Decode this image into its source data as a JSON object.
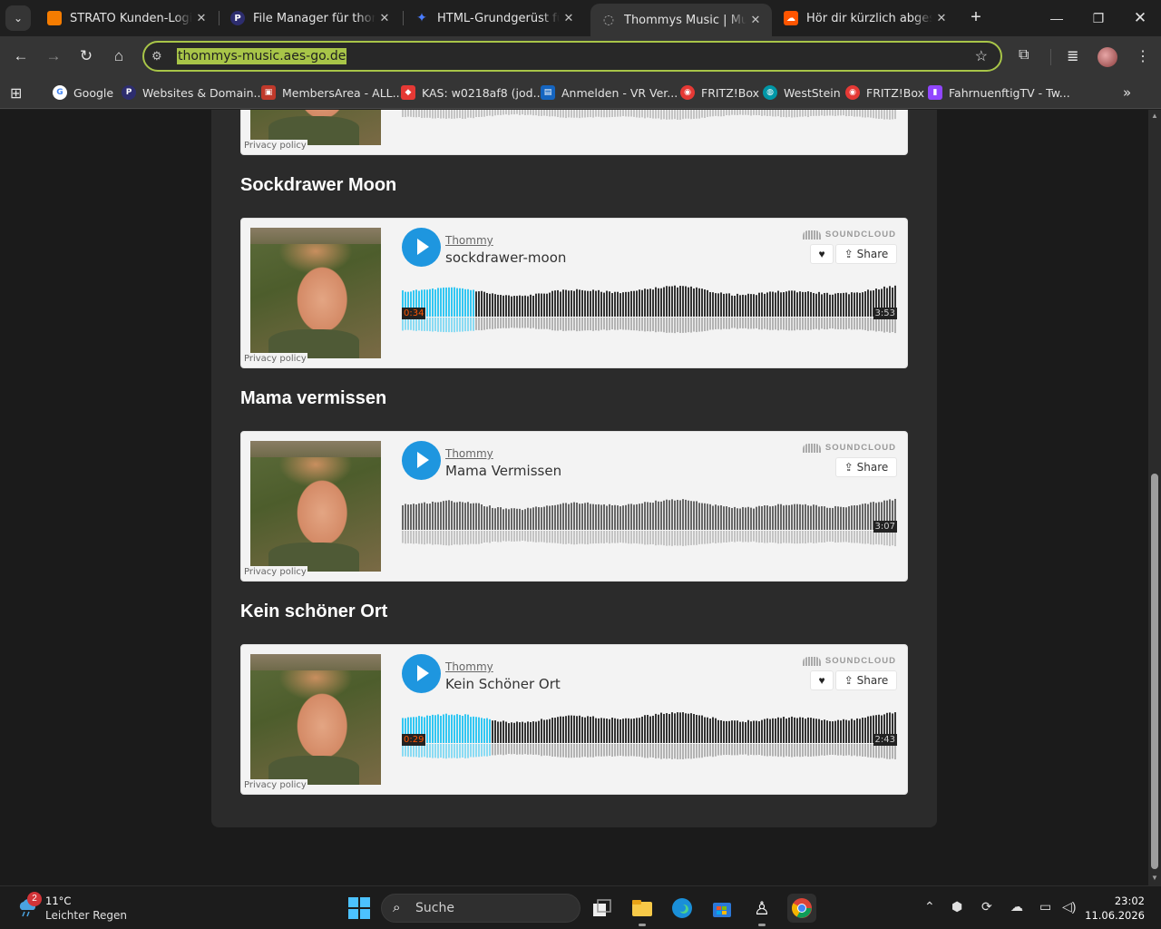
{
  "browser": {
    "tabs": [
      {
        "title": "STRATO Kunden-Login | R",
        "favicon_color": "#f57c00",
        "favicon_glyph": ""
      },
      {
        "title": "File Manager für thommy",
        "favicon_color": "#2d2d6e",
        "favicon_glyph": "P"
      },
      {
        "title": "HTML-Grundgerüst für M",
        "favicon_color": "#4a7dff",
        "favicon_glyph": "✦"
      },
      {
        "title": "Thommys Music | Music-",
        "favicon_color": "#5a5a5a",
        "favicon_glyph": "◌"
      },
      {
        "title": "Hör dir kürzlich abgespie",
        "favicon_color": "#ff5500",
        "favicon_glyph": "☁"
      }
    ],
    "url": "thommys-music.aes-go.de",
    "bookmarks": [
      {
        "label": "Google",
        "favicon_color": "#ffffff",
        "glyph": "G"
      },
      {
        "label": "Websites & Domain...",
        "favicon_color": "#2d2d6e",
        "glyph": "P"
      },
      {
        "label": "MembersArea - ALL...",
        "favicon_color": "#c0392b",
        "glyph": "▣"
      },
      {
        "label": "KAS: w0218af8 (jod...",
        "favicon_color": "#e53935",
        "glyph": "◆"
      },
      {
        "label": "Anmelden - VR Ver...",
        "favicon_color": "#1565c0",
        "glyph": "▤"
      },
      {
        "label": "FRITZ!Box",
        "favicon_color": "#e53935",
        "glyph": "◉"
      },
      {
        "label": "WestStein",
        "favicon_color": "#0097a7",
        "glyph": "◍"
      },
      {
        "label": "FRITZ!Box",
        "favicon_color": "#e53935",
        "glyph": "◉"
      },
      {
        "label": "FahrnuenftigTV - Tw...",
        "favicon_color": "#9146ff",
        "glyph": "▮"
      }
    ]
  },
  "page": {
    "privacy_label": "Privacy policy",
    "soundcloud_label": "SOUNDCLOUD",
    "share_label": "Share",
    "like_icon": "heart-icon",
    "songs": [
      {
        "heading": "Sockdrawer Moon",
        "artist": "Thommy",
        "track": "sockdrawer-moon",
        "current": "0:34",
        "duration": "3:53",
        "progress": 0.146,
        "liked_button": true
      },
      {
        "heading": "Mama vermissen",
        "artist": "Thommy",
        "track": "Mama Vermissen",
        "current": "",
        "duration": "3:07",
        "progress": 0,
        "liked_button": false
      },
      {
        "heading": "Kein schöner Ort",
        "artist": "Thommy",
        "track": "Kein Schöner Ort",
        "current": "0:29",
        "duration": "2:43",
        "progress": 0.178,
        "liked_button": true
      }
    ],
    "colors": {
      "played": "#33c7f2",
      "unplayed_top": "#333333",
      "unplayed_bottom": "#b3b3b3",
      "idle_top": "#666666",
      "idle_bottom": "#c4c4c4",
      "play_button": "#1e96df"
    }
  },
  "taskbar": {
    "weather_badge": "2",
    "temperature": "11°C",
    "condition": "Leichter Regen",
    "search_placeholder": "Suche",
    "time": "23:02",
    "date": "11.06.2026"
  }
}
